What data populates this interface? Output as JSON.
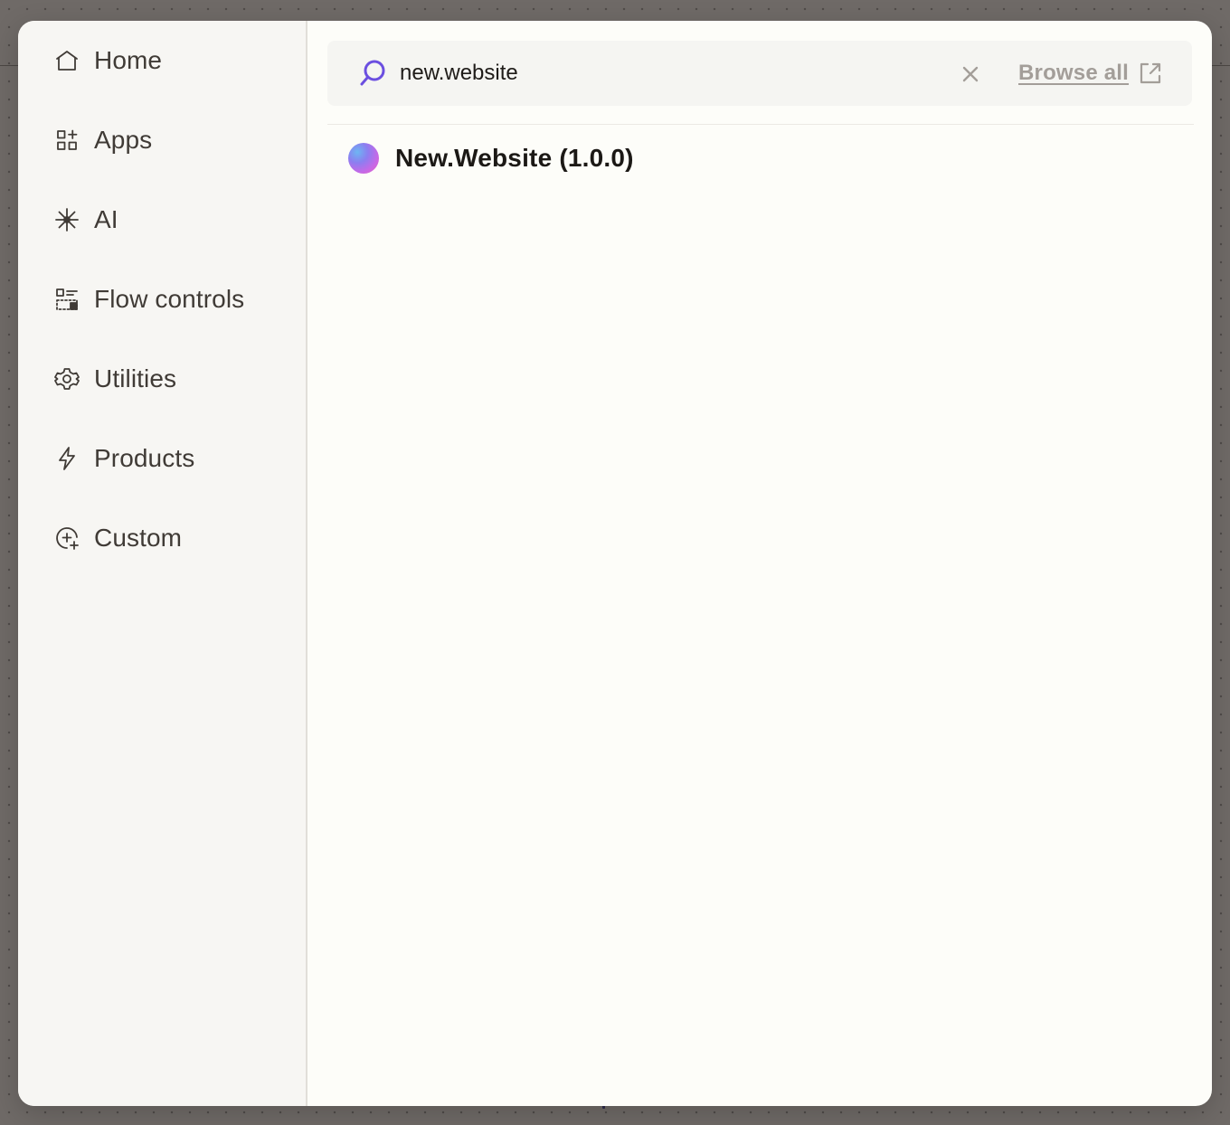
{
  "sidebar": {
    "items": [
      {
        "label": "Home",
        "icon": "home-icon"
      },
      {
        "label": "Apps",
        "icon": "apps-grid-icon"
      },
      {
        "label": "AI",
        "icon": "sparkle-icon"
      },
      {
        "label": "Flow controls",
        "icon": "flow-controls-icon"
      },
      {
        "label": "Utilities",
        "icon": "gear-icon"
      },
      {
        "label": "Products",
        "icon": "lightning-icon"
      },
      {
        "label": "Custom",
        "icon": "custom-plus-icon"
      }
    ]
  },
  "search": {
    "value": "new.website",
    "browse_all_label": "Browse all"
  },
  "results": [
    {
      "label": "New.Website (1.0.0)",
      "icon": "app-logo-gradient"
    }
  ],
  "colors": {
    "accent": "#6b4fe0",
    "sidebar_bg": "#f7f6f3",
    "main_bg": "#fdfdf9",
    "overlay": "#6f6a67"
  }
}
